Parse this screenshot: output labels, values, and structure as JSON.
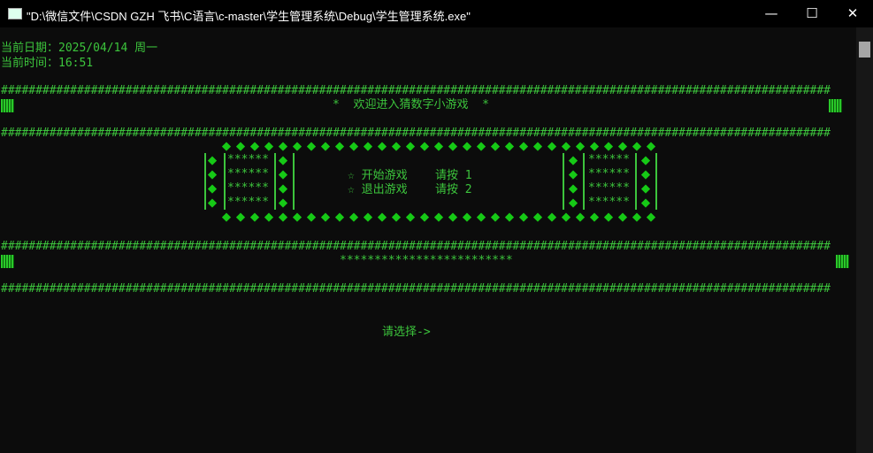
{
  "window": {
    "title": "\"D:\\微信文件\\CSDN GZH 飞书\\C语言\\c-master\\学生管理系统\\Debug\\学生管理系统.exe\"",
    "minimize": "—",
    "maximize": "☐",
    "close": "✕"
  },
  "console": {
    "date_line": "当前日期：2025/04/14 周一",
    "time_line": "当前时间：16:51",
    "hash_line": "########################################################################################################################",
    "welcome": "*  欢迎进入猜数字小游戏  *",
    "stars_row": "******",
    "menu": [
      "☆ 开始游戏    请按 1",
      "☆ 退出游戏    请按 2"
    ],
    "banner2": "*************************",
    "prompt": "请选择->"
  },
  "colors": {
    "text": "#3cc43c",
    "diamond": "#16c916",
    "background": "#0c0c0c"
  }
}
